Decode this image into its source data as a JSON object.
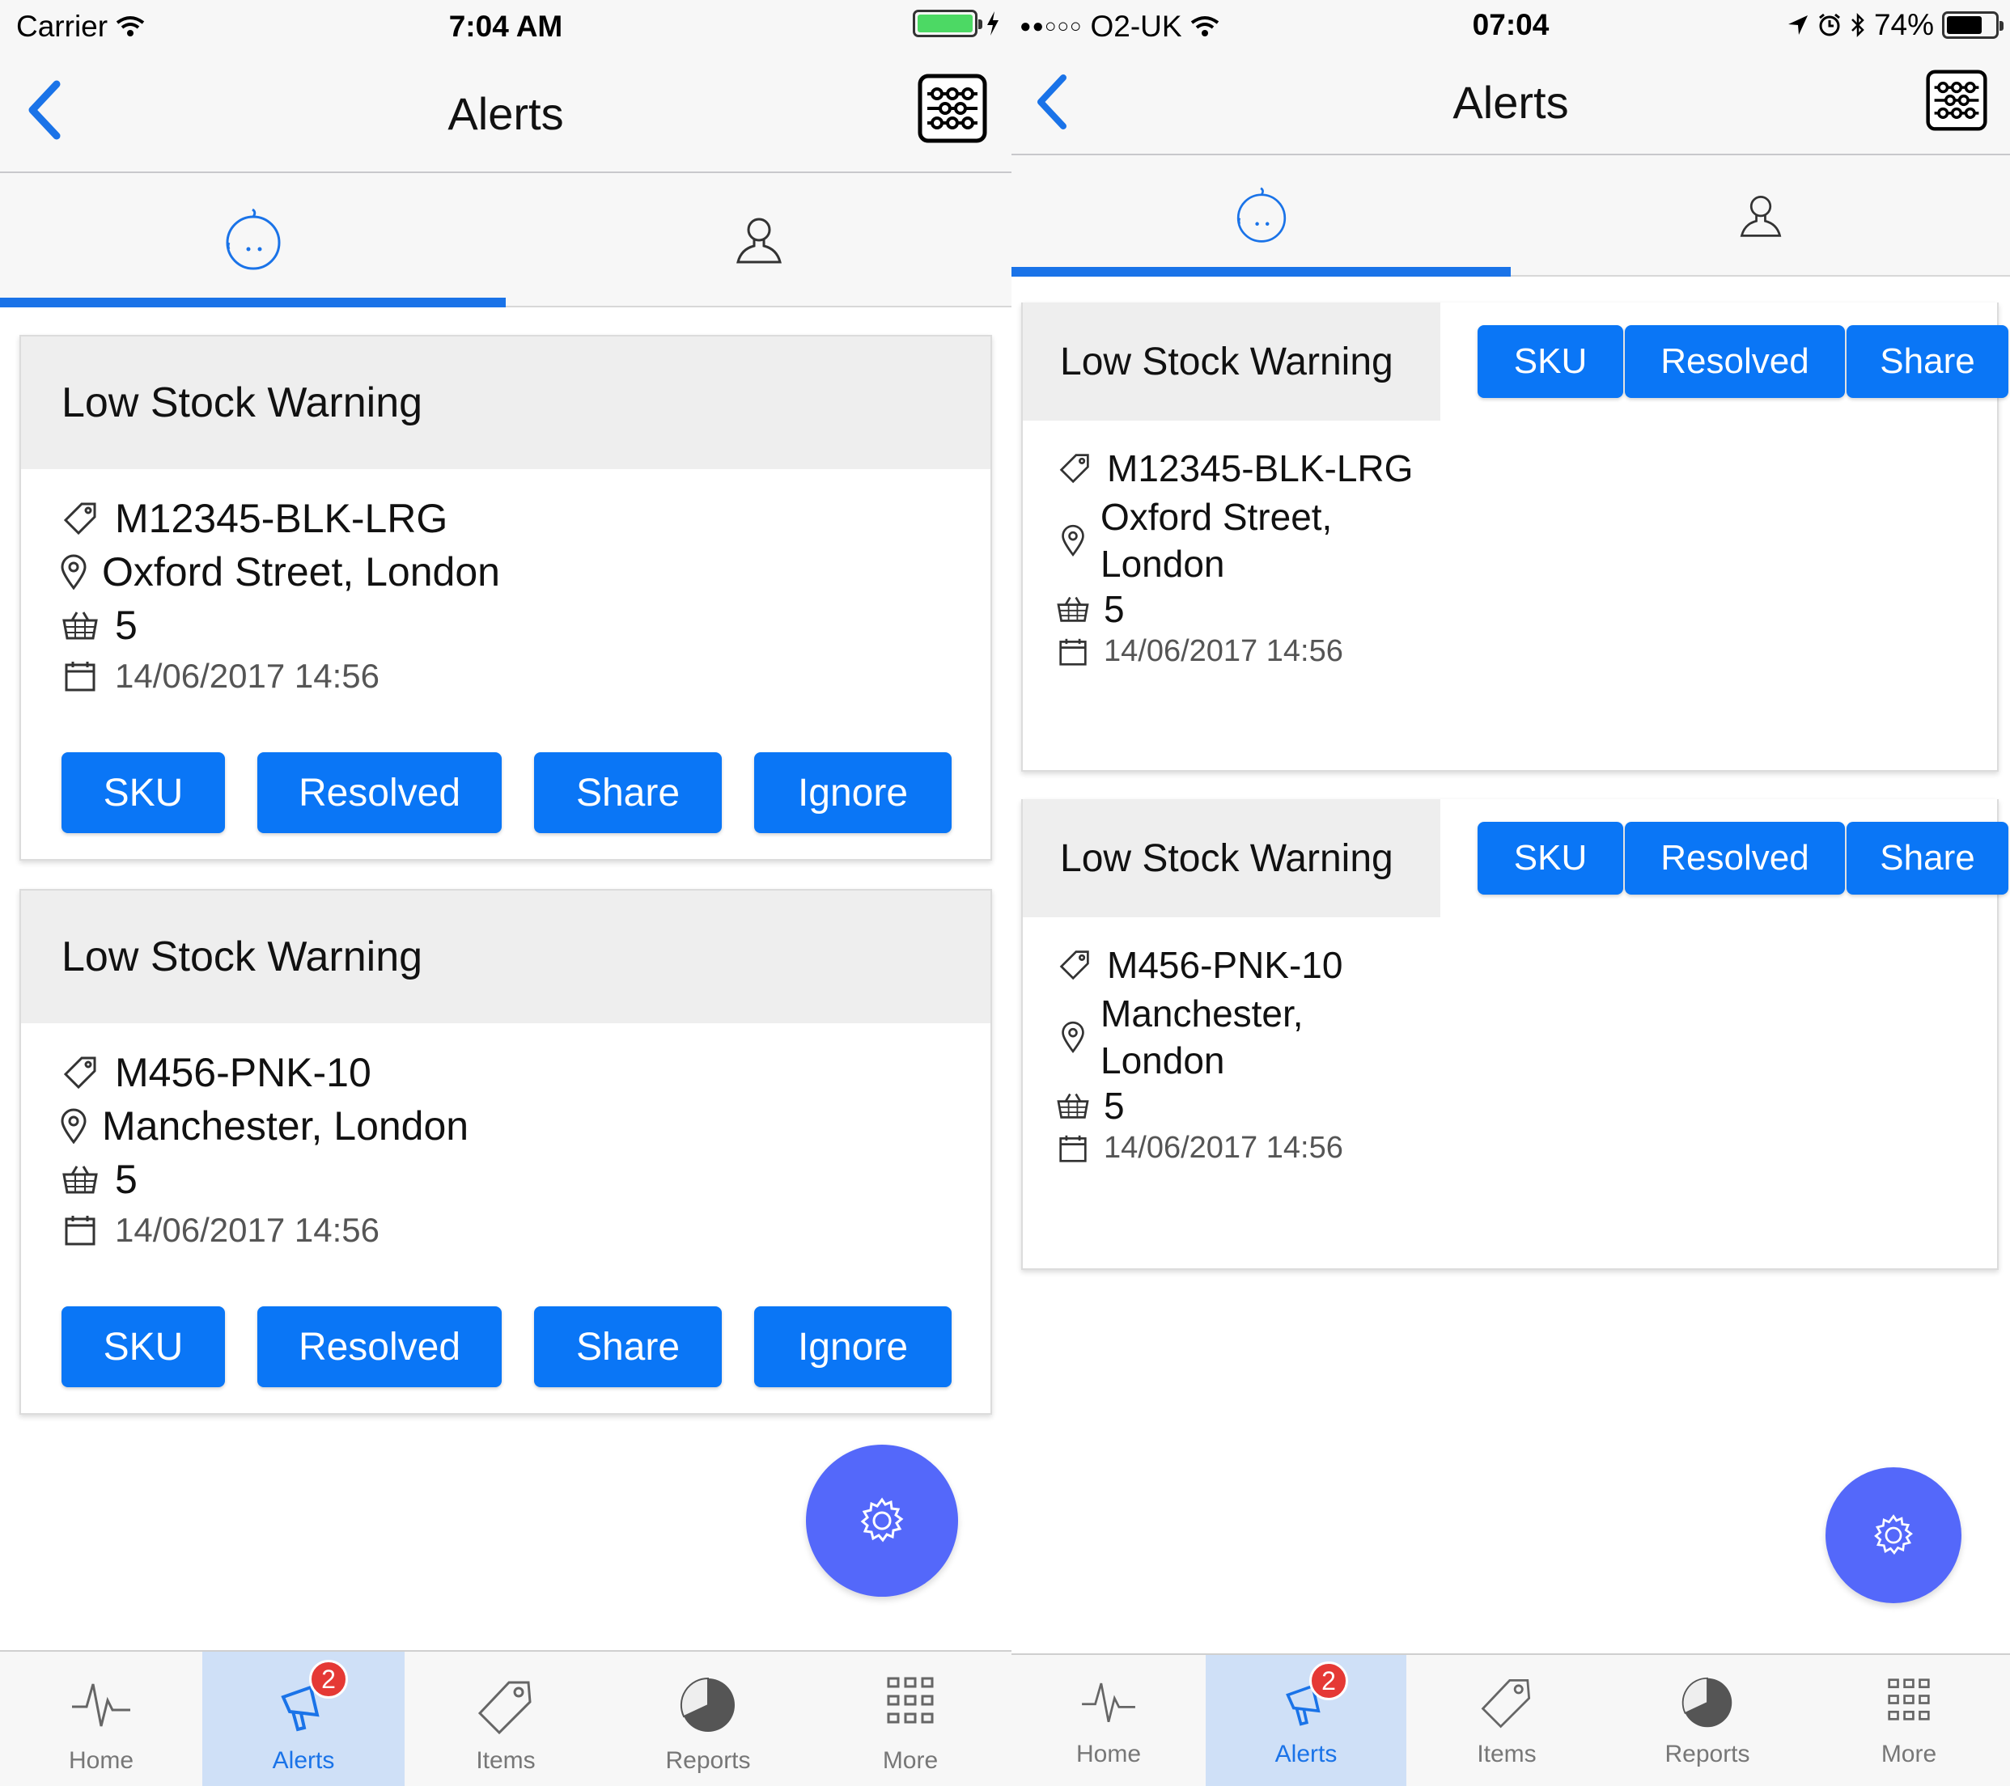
{
  "colors": {
    "accent": "#0a76f6",
    "fab": "#5468fa",
    "badge": "#e53935",
    "battery_green": "#4cd964"
  },
  "left": {
    "status": {
      "carrier": "Carrier",
      "time": "7:04 AM"
    },
    "nav": {
      "title": "Alerts"
    },
    "alerts": [
      {
        "title": "Low Stock Warning",
        "sku": "M12345-BLK-LRG",
        "location": "Oxford Street, London",
        "qty": "5",
        "date": "14/06/2017 14:56",
        "buttons": [
          "SKU",
          "Resolved",
          "Share",
          "Ignore"
        ]
      },
      {
        "title": "Low Stock Warning",
        "sku": "M456-PNK-10",
        "location": "Manchester, London",
        "qty": "5",
        "date": "14/06/2017 14:56",
        "buttons": [
          "SKU",
          "Resolved",
          "Share",
          "Ignore"
        ]
      }
    ],
    "tabbar": [
      {
        "label": "Home",
        "icon": "pulse-icon"
      },
      {
        "label": "Alerts",
        "icon": "megaphone-icon",
        "badge": "2",
        "active": true
      },
      {
        "label": "Items",
        "icon": "tag-icon"
      },
      {
        "label": "Reports",
        "icon": "pie-chart-icon"
      },
      {
        "label": "More",
        "icon": "grid-icon"
      }
    ]
  },
  "right": {
    "status": {
      "carrier": "O2-UK",
      "time": "07:04",
      "battery": "74%"
    },
    "nav": {
      "title": "Alerts"
    },
    "alerts": [
      {
        "title": "Low Stock Warning",
        "sku": "M12345-BLK-LRG",
        "location_line1": "Oxford Street,",
        "location_line2": "London",
        "qty": "5",
        "date": "14/06/2017 14:56",
        "buttons": [
          "SKU",
          "Resolved",
          "Share"
        ]
      },
      {
        "title": "Low Stock Warning",
        "sku": "M456-PNK-10",
        "location_line1": "Manchester,",
        "location_line2": "London",
        "qty": "5",
        "date": "14/06/2017 14:56",
        "buttons": [
          "SKU",
          "Resolved",
          "Share"
        ]
      }
    ],
    "tabbar": [
      {
        "label": "Home",
        "icon": "pulse-icon"
      },
      {
        "label": "Alerts",
        "icon": "megaphone-icon",
        "badge": "2",
        "active": true
      },
      {
        "label": "Items",
        "icon": "tag-icon"
      },
      {
        "label": "Reports",
        "icon": "pie-chart-icon"
      },
      {
        "label": "More",
        "icon": "grid-icon"
      }
    ]
  }
}
